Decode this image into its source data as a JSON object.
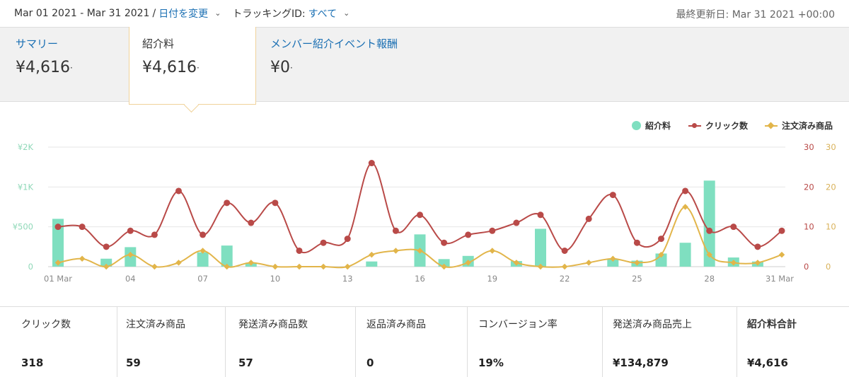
{
  "topbar": {
    "date_range": "Mar 01 2021 - Mar 31 2021",
    "separator": "/",
    "change_date_label": "日付を変更",
    "tracking_label": "トラッキングID:",
    "tracking_value": "すべて",
    "last_updated": "最終更新日: Mar 31 2021 +00:00"
  },
  "tabs": [
    {
      "label": "サマリー",
      "value": "¥4,616"
    },
    {
      "label": "紹介料",
      "value": "¥4,616"
    },
    {
      "label": "メンバー紹介イベント報酬",
      "value": "¥0"
    }
  ],
  "tab_value_suffix": "·",
  "colors": {
    "bars": "#7fdfc0",
    "clicks": "#b94a48",
    "orders": "#e2b54a",
    "grid": "#e6e6e6",
    "axis_left": "#8fd8b8",
    "axis_right_clicks": "#b94a48",
    "axis_right_orders": "#d9b25a",
    "link": "#1a6fb3"
  },
  "chart_data": {
    "type": "bar",
    "legend_position": "top-right",
    "legend": [
      "紹介料",
      "クリック数",
      "注文済み商品"
    ],
    "x_ticks": [
      "01 Mar",
      "04",
      "07",
      "10",
      "13",
      "16",
      "19",
      "22",
      "25",
      "28",
      "31 Mar"
    ],
    "x_tick_days": [
      1,
      4,
      7,
      10,
      13,
      16,
      19,
      22,
      25,
      28,
      31
    ],
    "days": [
      1,
      2,
      3,
      4,
      5,
      6,
      7,
      8,
      9,
      10,
      11,
      12,
      13,
      14,
      15,
      16,
      17,
      18,
      19,
      20,
      21,
      22,
      23,
      24,
      25,
      26,
      27,
      28,
      29,
      30,
      31
    ],
    "y_left": {
      "ticks": [
        "0",
        "¥500",
        "¥1K",
        "¥2K"
      ],
      "tick_values": [
        0,
        500,
        1000,
        1500
      ]
    },
    "y_right_clicks": {
      "ticks": [
        "0",
        "10",
        "20",
        "30"
      ],
      "range": [
        0,
        30
      ]
    },
    "y_right_orders": {
      "ticks": [
        "0",
        "10",
        "20",
        "30"
      ],
      "range": [
        0,
        30
      ]
    },
    "grid": true,
    "series": [
      {
        "name": "紹介料",
        "type": "bar",
        "axis": "left",
        "values": [
          600,
          0,
          100,
          245,
          0,
          0,
          180,
          265,
          50,
          0,
          0,
          0,
          0,
          65,
          0,
          405,
          95,
          135,
          0,
          70,
          475,
          0,
          0,
          90,
          75,
          165,
          300,
          1080,
          115,
          65,
          0
        ]
      },
      {
        "name": "クリック数",
        "type": "line",
        "axis": "right_clicks",
        "values": [
          10,
          10,
          5,
          9,
          8,
          19,
          8,
          16,
          11,
          16,
          4,
          6,
          7,
          26,
          9,
          13,
          6,
          8,
          9,
          11,
          13,
          4,
          12,
          18,
          6,
          7,
          19,
          9,
          10,
          5,
          9
        ]
      },
      {
        "name": "注文済み商品",
        "type": "line",
        "axis": "right_orders",
        "values": [
          1,
          2,
          0,
          3,
          0,
          1,
          4,
          0,
          1,
          0,
          0,
          0,
          0,
          3,
          4,
          4,
          0,
          1,
          4,
          1,
          0,
          0,
          1,
          2,
          1,
          3,
          15,
          3,
          1,
          1,
          3
        ]
      }
    ]
  },
  "stats": [
    {
      "label": "クリック数",
      "value": "318"
    },
    {
      "label": "注文済み商品",
      "value": "59"
    },
    {
      "label": "発送済み商品数",
      "value": "57"
    },
    {
      "label": "返品済み商品",
      "value": "0"
    },
    {
      "label": "コンバージョン率",
      "value": "19%"
    },
    {
      "label": "発送済み商品売上",
      "value": "¥134,879"
    },
    {
      "label": "紹介料合計",
      "value": "¥4,616"
    }
  ]
}
